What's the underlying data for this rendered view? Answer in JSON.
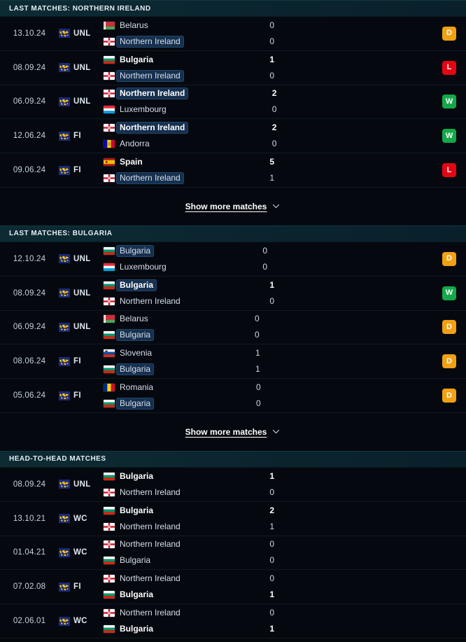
{
  "accent": {
    "win": "#14a84a",
    "draw": "#f2a013",
    "loss": "#e30613",
    "highlight_bg": "#16304f",
    "header_bg": "#0d2b33",
    "page_bg": "#04080d"
  },
  "show_more": {
    "label": "Show more matches",
    "icon": "chevron-down-icon"
  },
  "sections": [
    {
      "id": "last-matches-northern-ireland",
      "title": "LAST MATCHES: NORTHERN IRELAND",
      "has_show_more": true,
      "matches": [
        {
          "date": "13.10.24",
          "competition": "UNL",
          "competition_icon": "world-map-icon",
          "home": {
            "team": "Belarus",
            "flag": "belarus-flag",
            "score": "0",
            "bold": false,
            "highlight": false
          },
          "away": {
            "team": "Northern Ireland",
            "flag": "northern-ireland-flag",
            "score": "0",
            "bold": false,
            "highlight": true
          },
          "result": "D"
        },
        {
          "date": "08.09.24",
          "competition": "UNL",
          "competition_icon": "world-map-icon",
          "home": {
            "team": "Bulgaria",
            "flag": "bulgaria-flag",
            "score": "1",
            "bold": true,
            "highlight": false
          },
          "away": {
            "team": "Northern Ireland",
            "flag": "northern-ireland-flag",
            "score": "0",
            "bold": false,
            "highlight": true
          },
          "result": "L"
        },
        {
          "date": "06.09.24",
          "competition": "UNL",
          "competition_icon": "world-map-icon",
          "home": {
            "team": "Northern Ireland",
            "flag": "northern-ireland-flag",
            "score": "2",
            "bold": true,
            "highlight": true
          },
          "away": {
            "team": "Luxembourg",
            "flag": "luxembourg-flag",
            "score": "0",
            "bold": false,
            "highlight": false
          },
          "result": "W"
        },
        {
          "date": "12.06.24",
          "competition": "FI",
          "competition_icon": "world-map-icon",
          "home": {
            "team": "Northern Ireland",
            "flag": "northern-ireland-flag",
            "score": "2",
            "bold": true,
            "highlight": true
          },
          "away": {
            "team": "Andorra",
            "flag": "andorra-flag",
            "score": "0",
            "bold": false,
            "highlight": false
          },
          "result": "W"
        },
        {
          "date": "09.06.24",
          "competition": "FI",
          "competition_icon": "world-map-icon",
          "home": {
            "team": "Spain",
            "flag": "spain-flag",
            "score": "5",
            "bold": true,
            "highlight": false
          },
          "away": {
            "team": "Northern Ireland",
            "flag": "northern-ireland-flag",
            "score": "1",
            "bold": false,
            "highlight": true
          },
          "result": "L"
        }
      ]
    },
    {
      "id": "last-matches-bulgaria",
      "title": "LAST MATCHES: BULGARIA",
      "has_show_more": true,
      "matches": [
        {
          "date": "12.10.24",
          "competition": "UNL",
          "competition_icon": "world-map-icon",
          "home": {
            "team": "Bulgaria",
            "flag": "bulgaria-flag",
            "score": "0",
            "bold": false,
            "highlight": true
          },
          "away": {
            "team": "Luxembourg",
            "flag": "luxembourg-flag",
            "score": "0",
            "bold": false,
            "highlight": false
          },
          "result": "D"
        },
        {
          "date": "08.09.24",
          "competition": "UNL",
          "competition_icon": "world-map-icon",
          "home": {
            "team": "Bulgaria",
            "flag": "bulgaria-flag",
            "score": "1",
            "bold": true,
            "highlight": true
          },
          "away": {
            "team": "Northern Ireland",
            "flag": "northern-ireland-flag",
            "score": "0",
            "bold": false,
            "highlight": false
          },
          "result": "W"
        },
        {
          "date": "06.09.24",
          "competition": "UNL",
          "competition_icon": "world-map-icon",
          "home": {
            "team": "Belarus",
            "flag": "belarus-flag",
            "score": "0",
            "bold": false,
            "highlight": false
          },
          "away": {
            "team": "Bulgaria",
            "flag": "bulgaria-flag",
            "score": "0",
            "bold": false,
            "highlight": true
          },
          "result": "D"
        },
        {
          "date": "08.06.24",
          "competition": "FI",
          "competition_icon": "world-map-icon",
          "home": {
            "team": "Slovenia",
            "flag": "slovenia-flag",
            "score": "1",
            "bold": false,
            "highlight": false
          },
          "away": {
            "team": "Bulgaria",
            "flag": "bulgaria-flag",
            "score": "1",
            "bold": false,
            "highlight": true
          },
          "result": "D"
        },
        {
          "date": "05.06.24",
          "competition": "FI",
          "competition_icon": "world-map-icon",
          "home": {
            "team": "Romania",
            "flag": "romania-flag",
            "score": "0",
            "bold": false,
            "highlight": false
          },
          "away": {
            "team": "Bulgaria",
            "flag": "bulgaria-flag",
            "score": "0",
            "bold": false,
            "highlight": true
          },
          "result": "D"
        }
      ]
    },
    {
      "id": "head-to-head-matches",
      "title": "HEAD-TO-HEAD MATCHES",
      "has_show_more": false,
      "matches": [
        {
          "date": "08.09.24",
          "competition": "UNL",
          "competition_icon": "world-map-icon",
          "home": {
            "team": "Bulgaria",
            "flag": "bulgaria-flag",
            "score": "1",
            "bold": true,
            "highlight": false
          },
          "away": {
            "team": "Northern Ireland",
            "flag": "northern-ireland-flag",
            "score": "0",
            "bold": false,
            "highlight": false
          },
          "result": ""
        },
        {
          "date": "13.10.21",
          "competition": "WC",
          "competition_icon": "world-map-icon",
          "home": {
            "team": "Bulgaria",
            "flag": "bulgaria-flag",
            "score": "2",
            "bold": true,
            "highlight": false
          },
          "away": {
            "team": "Northern Ireland",
            "flag": "northern-ireland-flag",
            "score": "1",
            "bold": false,
            "highlight": false
          },
          "result": ""
        },
        {
          "date": "01.04.21",
          "competition": "WC",
          "competition_icon": "world-map-icon",
          "home": {
            "team": "Northern Ireland",
            "flag": "northern-ireland-flag",
            "score": "0",
            "bold": false,
            "highlight": false
          },
          "away": {
            "team": "Bulgaria",
            "flag": "bulgaria-flag",
            "score": "0",
            "bold": false,
            "highlight": false
          },
          "result": ""
        },
        {
          "date": "07.02.08",
          "competition": "FI",
          "competition_icon": "world-map-icon",
          "home": {
            "team": "Northern Ireland",
            "flag": "northern-ireland-flag",
            "score": "0",
            "bold": false,
            "highlight": false
          },
          "away": {
            "team": "Bulgaria",
            "flag": "bulgaria-flag",
            "score": "1",
            "bold": true,
            "highlight": false
          },
          "result": ""
        },
        {
          "date": "02.06.01",
          "competition": "WC",
          "competition_icon": "world-map-icon",
          "home": {
            "team": "Northern Ireland",
            "flag": "northern-ireland-flag",
            "score": "0",
            "bold": false,
            "highlight": false
          },
          "away": {
            "team": "Bulgaria",
            "flag": "bulgaria-flag",
            "score": "1",
            "bold": true,
            "highlight": false
          },
          "result": ""
        }
      ]
    }
  ]
}
